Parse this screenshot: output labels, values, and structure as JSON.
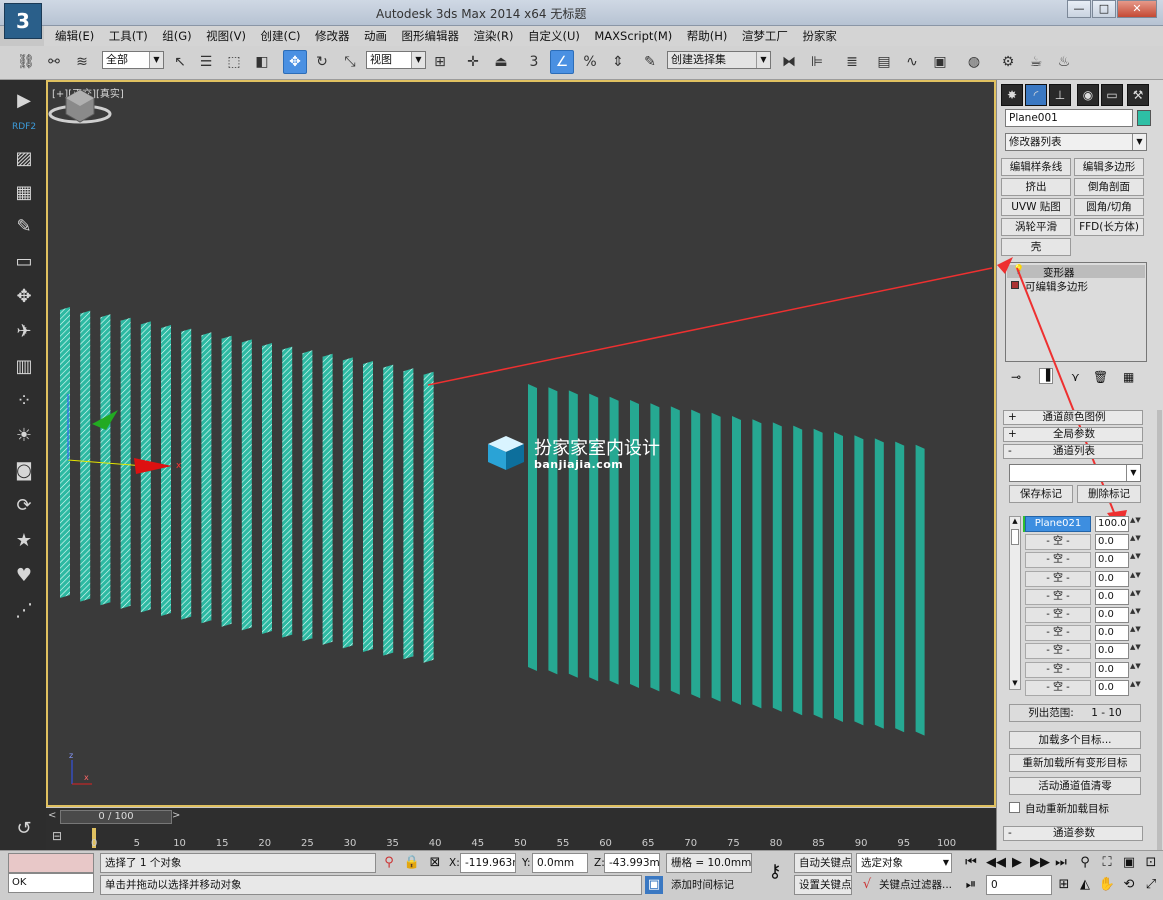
{
  "window": {
    "title": "Autodesk 3ds Max  2014 x64       无标题",
    "minimize": "—",
    "maximize": "□",
    "close": "✕"
  },
  "menu": [
    "编辑(E)",
    "工具(T)",
    "组(G)",
    "视图(V)",
    "创建(C)",
    "修改器",
    "动画",
    "图形编辑器",
    "渲染(R)",
    "自定义(U)",
    "MAXScript(M)",
    "帮助(H)",
    "渲梦工厂",
    "扮家家"
  ],
  "toolbar": {
    "selection_filter": "全部",
    "ref_coord": "视图",
    "named_selection": "创建选择集",
    "snap_number": "3"
  },
  "left_toolbar": {
    "rdf_label": "RDF2"
  },
  "viewport": {
    "label": "[+][正交][真实]",
    "watermark_title": "扮家家室内设计",
    "watermark_url": "banjiajia.com",
    "axis_x": "x",
    "axis_y": "y",
    "axis_z": "z"
  },
  "timeslider": {
    "position": "0 / 100",
    "prev": "<",
    "next": ">",
    "ticks": [
      "0",
      "5",
      "10",
      "15",
      "20",
      "25",
      "30",
      "35",
      "40",
      "45",
      "50",
      "55",
      "60",
      "65",
      "70",
      "75",
      "80",
      "85",
      "90",
      "95",
      "100"
    ]
  },
  "command_panel": {
    "object_name": "Plane001",
    "object_color": "#2ebfa5",
    "modifier_list": "修改器列表",
    "modifier_buttons": [
      "编辑样条线",
      "编辑多边形",
      "挤出",
      "倒角剖面",
      "UVW 贴图",
      "圆角/切角",
      "涡轮平滑",
      "FFD(长方体)",
      "壳"
    ],
    "stack": [
      "变形器",
      "可编辑多边形"
    ],
    "rollouts": {
      "channel_color_legend": "通道颜色图例",
      "global_params": "全局参数",
      "channel_list": "通道列表",
      "channel_params": "通道参数"
    },
    "save_marker": "保存标记",
    "delete_marker": "删除标记",
    "channels": [
      {
        "name": "Plane021",
        "value": "100.0"
      },
      {
        "name": "- 空 -",
        "value": "0.0"
      },
      {
        "name": "- 空 -",
        "value": "0.0"
      },
      {
        "name": "- 空 -",
        "value": "0.0"
      },
      {
        "name": "- 空 -",
        "value": "0.0"
      },
      {
        "name": "- 空 -",
        "value": "0.0"
      },
      {
        "name": "- 空 -",
        "value": "0.0"
      },
      {
        "name": "- 空 -",
        "value": "0.0"
      },
      {
        "name": "- 空 -",
        "value": "0.0"
      },
      {
        "name": "- 空 -",
        "value": "0.0"
      }
    ],
    "list_range_label": "列出范围:",
    "list_range_value": "1 - 10",
    "load_multiple": "加载多个目标...",
    "reload_all": "重新加载所有变形目标",
    "zero_active": "活动通道值清零",
    "auto_reload": "自动重新加载目标"
  },
  "status": {
    "listener_value": "OK",
    "selection_info": "选择了 1 个对象",
    "prompt": "单击并拖动以选择并移动对象",
    "x_label": "X:",
    "x_value": "-119.963m",
    "y_label": "Y:",
    "y_value": "0.0mm",
    "z_label": "Z:",
    "z_value": "-43.993mm",
    "grid": "栅格 = 10.0mm",
    "add_time_tag": "添加时间标记",
    "auto_key": "自动关键点",
    "set_key": "设置关键点",
    "selected_object": "选定对象",
    "key_filter": "关键点过滤器...",
    "frame": "0"
  }
}
